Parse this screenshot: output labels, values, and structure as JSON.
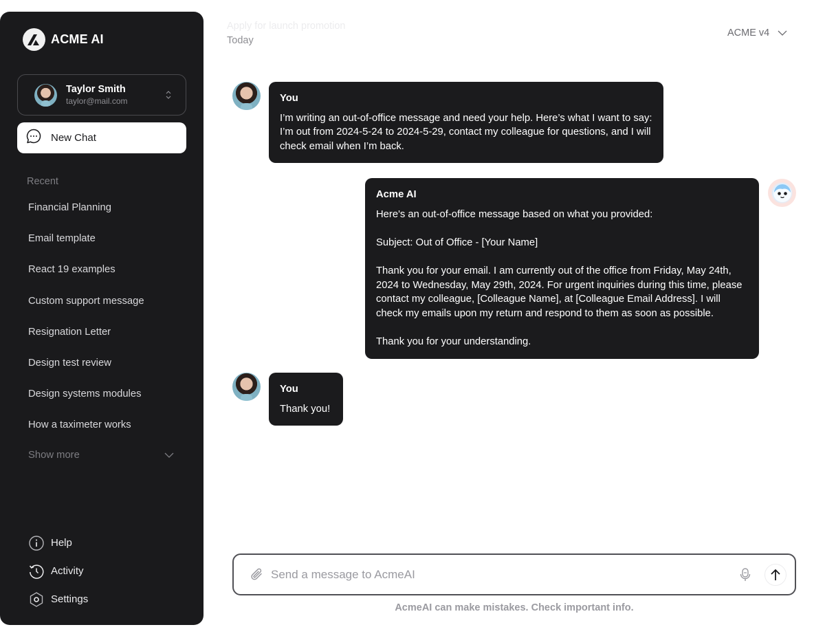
{
  "app": {
    "brand_name": "ACME AI"
  },
  "user": {
    "name": "Taylor Smith",
    "email": "taylor@mail.com"
  },
  "sidebar": {
    "new_chat_label": "New Chat",
    "recent_heading": "Recent",
    "recent_items": [
      {
        "label": "Financial Planning"
      },
      {
        "label": "Email template"
      },
      {
        "label": "React 19 examples"
      },
      {
        "label": "Custom support message"
      },
      {
        "label": "Resignation Letter"
      },
      {
        "label": "Design test review"
      },
      {
        "label": "Design systems modules"
      },
      {
        "label": "How a taximeter works"
      }
    ],
    "show_more_label": "Show more",
    "bottom_nav": [
      {
        "label": "Help",
        "icon": "info-icon"
      },
      {
        "label": "Activity",
        "icon": "history-icon"
      },
      {
        "label": "Settings",
        "icon": "settings-icon"
      }
    ]
  },
  "header": {
    "conversation_title": "Apply for launch promotion",
    "date_label": "Today",
    "model_name": "ACME v4"
  },
  "messages": [
    {
      "sender": "You",
      "role": "user",
      "text": "I’m writing an out-of-office message and need your help. Here’s what I want to say: I’m out from 2024-5-24 to 2024-5-29, contact my colleague for questions, and I will check email when I’m back."
    },
    {
      "sender": "Acme AI",
      "role": "assistant",
      "text": "Here's an out-of-office message based on what you provided:\n\nSubject: Out of Office - [Your Name]\n\nThank you for your email. I am currently out of the office from Friday, May 24th, 2024 to Wednesday, May 29th, 2024. For urgent inquiries during this time, please contact my colleague, [Colleague Name], at [Colleague Email Address]. I will check my emails upon my return and respond to them as soon as possible.\n\nThank you for your understanding."
    },
    {
      "sender": "You",
      "role": "user",
      "text": "Thank you!"
    }
  ],
  "composer": {
    "placeholder": "Send a message to AcmeAI",
    "value": "",
    "disclaimer": "AcmeAI can make mistakes. Check important info."
  }
}
